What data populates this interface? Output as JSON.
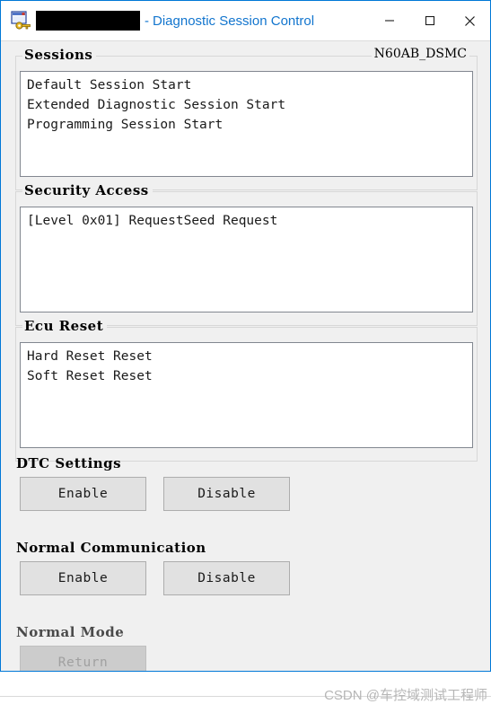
{
  "window": {
    "icon": "window-key-icon",
    "title_redacted": "",
    "title_separator": "-",
    "title": "Diagnostic Session Control",
    "accent_color": "#1275ce",
    "frame_color": "#0078d7",
    "background": "#f0f0f0",
    "controls": {
      "minimize": "minimize-icon",
      "maximize": "maximize-icon",
      "close": "close-icon"
    }
  },
  "sessions": {
    "label": "Sessions",
    "tag": "N60AB_DSMC",
    "items": [
      "Default Session Start",
      "Extended Diagnostic Session Start",
      "Programming Session Start"
    ]
  },
  "security_access": {
    "label": "Security Access",
    "items": [
      "[Level 0x01] RequestSeed Request"
    ]
  },
  "ecu_reset": {
    "label": "Ecu Reset",
    "items": [
      "Hard Reset Reset",
      "Soft Reset Reset"
    ]
  },
  "dtc_settings": {
    "label": "DTC Settings",
    "enable_label": "Enable",
    "disable_label": "Disable"
  },
  "normal_communication": {
    "label": "Normal Communication",
    "enable_label": "Enable",
    "disable_label": "Disable"
  },
  "normal_mode": {
    "label": "Normal Mode",
    "return_label": "Return"
  },
  "watermark": {
    "text": "CSDN @车控域测试工程师"
  }
}
